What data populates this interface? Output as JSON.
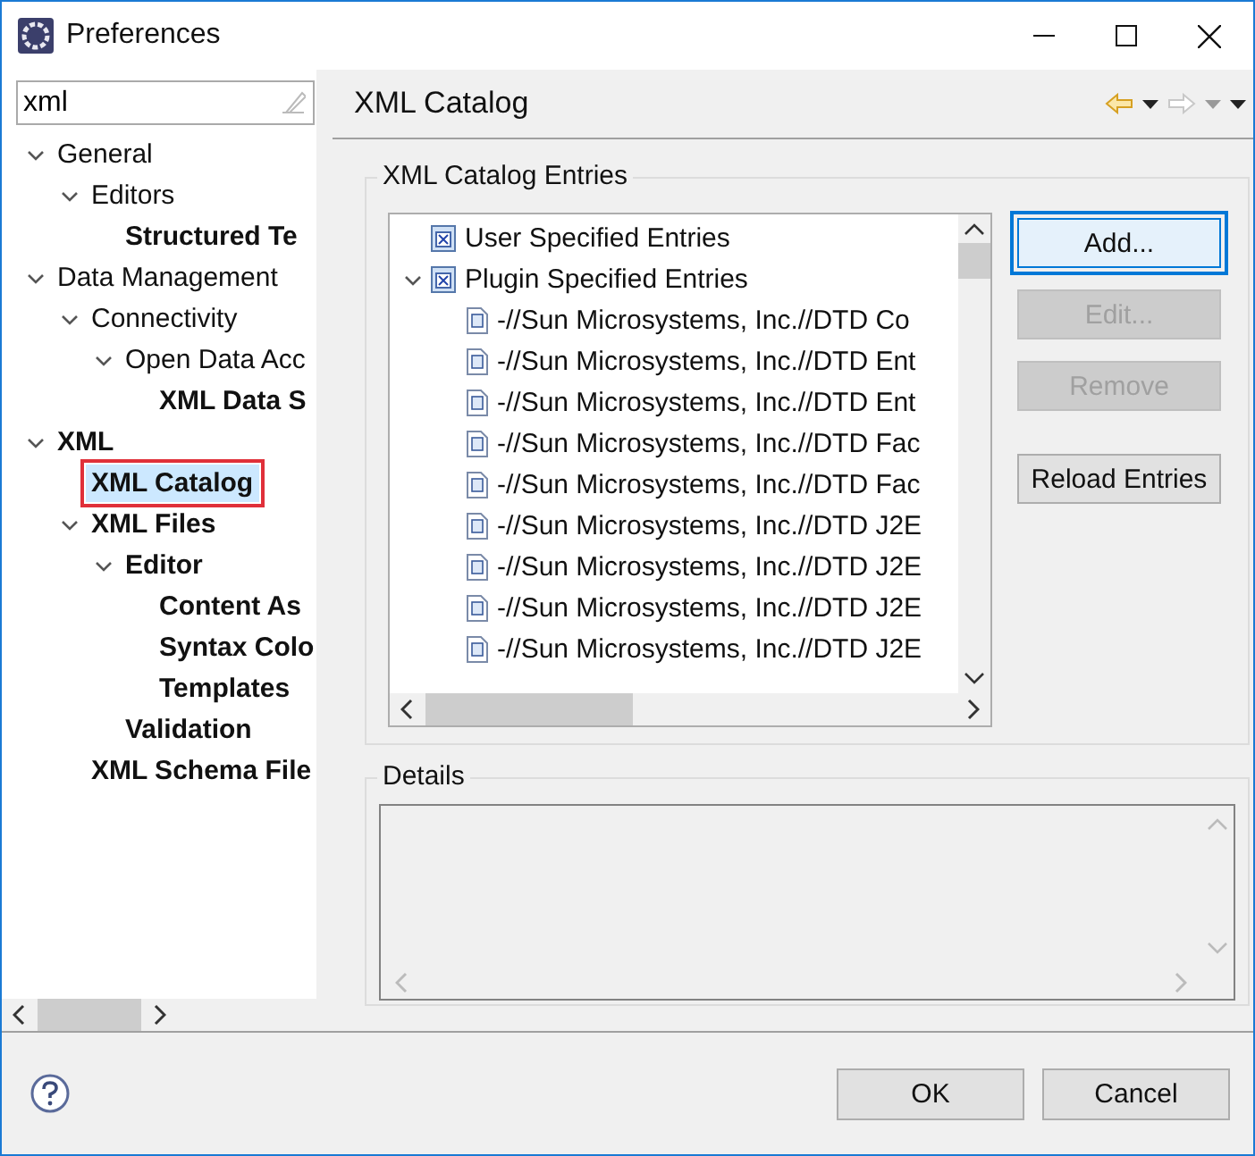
{
  "window": {
    "title": "Preferences"
  },
  "sidebar": {
    "filter": {
      "value": "xml"
    },
    "tree": [
      {
        "label": "General",
        "match": false,
        "selected": false,
        "highlighted": false,
        "expanded": true,
        "children": [
          {
            "label": "Editors",
            "match": false,
            "selected": false,
            "highlighted": false,
            "expanded": true,
            "children": [
              {
                "label": "Structured Te",
                "match": true,
                "selected": false,
                "highlighted": false
              }
            ]
          }
        ]
      },
      {
        "label": "Data Management",
        "match": false,
        "selected": false,
        "highlighted": false,
        "expanded": true,
        "children": [
          {
            "label": "Connectivity",
            "match": false,
            "selected": false,
            "highlighted": false,
            "expanded": true,
            "children": [
              {
                "label": "Open Data Acc",
                "match": false,
                "selected": false,
                "highlighted": false,
                "expanded": true,
                "children": [
                  {
                    "label": "XML Data S",
                    "match": true,
                    "selected": false,
                    "highlighted": false
                  }
                ]
              }
            ]
          }
        ]
      },
      {
        "label": "XML",
        "match": true,
        "selected": false,
        "highlighted": false,
        "expanded": true,
        "children": [
          {
            "label": "XML Catalog",
            "match": true,
            "selected": true,
            "highlighted": true
          },
          {
            "label": "XML Files",
            "match": true,
            "selected": false,
            "highlighted": false,
            "expanded": true,
            "children": [
              {
                "label": "Editor",
                "match": true,
                "selected": false,
                "highlighted": false,
                "expanded": true,
                "children": [
                  {
                    "label": "Content As",
                    "match": true,
                    "selected": false,
                    "highlighted": false
                  },
                  {
                    "label": "Syntax Colo",
                    "match": true,
                    "selected": false,
                    "highlighted": false
                  },
                  {
                    "label": "Templates",
                    "match": true,
                    "selected": false,
                    "highlighted": false
                  }
                ]
              },
              {
                "label": "Validation",
                "match": true,
                "selected": false,
                "highlighted": false
              }
            ]
          },
          {
            "label": "XML Schema File",
            "match": true,
            "selected": false,
            "highlighted": false
          }
        ]
      }
    ]
  },
  "page": {
    "title": "XML Catalog",
    "entries_group": {
      "title": "XML Catalog Entries",
      "tree": [
        {
          "label": "User Specified Entries",
          "kind": "group"
        },
        {
          "label": "Plugin Specified Entries",
          "kind": "group",
          "expanded": true,
          "children": [
            {
              "label": "-//Sun Microsystems, Inc.//DTD Co",
              "kind": "entry"
            },
            {
              "label": "-//Sun Microsystems, Inc.//DTD Ent",
              "kind": "entry"
            },
            {
              "label": "-//Sun Microsystems, Inc.//DTD Ent",
              "kind": "entry"
            },
            {
              "label": "-//Sun Microsystems, Inc.//DTD Fac",
              "kind": "entry"
            },
            {
              "label": "-//Sun Microsystems, Inc.//DTD Fac",
              "kind": "entry"
            },
            {
              "label": "-//Sun Microsystems, Inc.//DTD J2E",
              "kind": "entry"
            },
            {
              "label": "-//Sun Microsystems, Inc.//DTD J2E",
              "kind": "entry"
            },
            {
              "label": "-//Sun Microsystems, Inc.//DTD J2E",
              "kind": "entry"
            },
            {
              "label": "-//Sun Microsystems, Inc.//DTD J2E",
              "kind": "entry"
            }
          ]
        }
      ],
      "buttons": [
        {
          "label": "Add...",
          "disabled": false,
          "focused": true,
          "highlighted": true
        },
        {
          "label": "Edit...",
          "disabled": true,
          "focused": false,
          "highlighted": false
        },
        {
          "label": "Remove",
          "disabled": true,
          "focused": false,
          "highlighted": false
        },
        {
          "label": "Reload Entries",
          "disabled": false,
          "focused": false,
          "highlighted": false
        }
      ]
    },
    "details_group": {
      "title": "Details"
    }
  },
  "buttons": [
    {
      "label": "OK"
    },
    {
      "label": "Cancel"
    }
  ]
}
